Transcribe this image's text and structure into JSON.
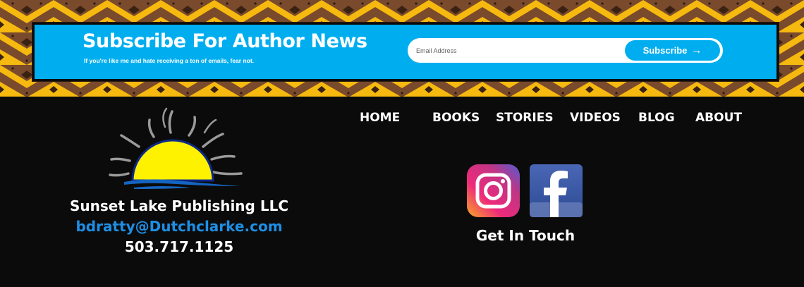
{
  "colors": {
    "band_brown": "#7a4a2c",
    "band_gold": "#f5b90f",
    "subscribe_blue": "#00aeef",
    "email_link": "#1e8fe6",
    "page_bg": "#0b0b0b",
    "sun_yellow": "#fff200",
    "water_blue": "#1565c0"
  },
  "subscribe": {
    "title": "Subscribe For Author News",
    "subtitle": "If you're like me and hate receiving a ton of emails, fear not.",
    "email_placeholder": "Email Address",
    "button_label": "Subscribe",
    "button_icon": "arrow-right-icon"
  },
  "nav": {
    "items": [
      {
        "label": "HOME"
      },
      {
        "label": "BOOKS"
      },
      {
        "label": "STORIES"
      },
      {
        "label": "VIDEOS"
      },
      {
        "label": "BLOG"
      },
      {
        "label": "ABOUT"
      }
    ]
  },
  "company": {
    "logo": "sunset-logo",
    "name": "Sunset Lake Publishing LLC",
    "email": "bdratty@Dutchclarke.com",
    "phone": "503.717.1125"
  },
  "social": {
    "icons": [
      "instagram-icon",
      "facebook-icon"
    ],
    "label": "Get In Touch"
  }
}
